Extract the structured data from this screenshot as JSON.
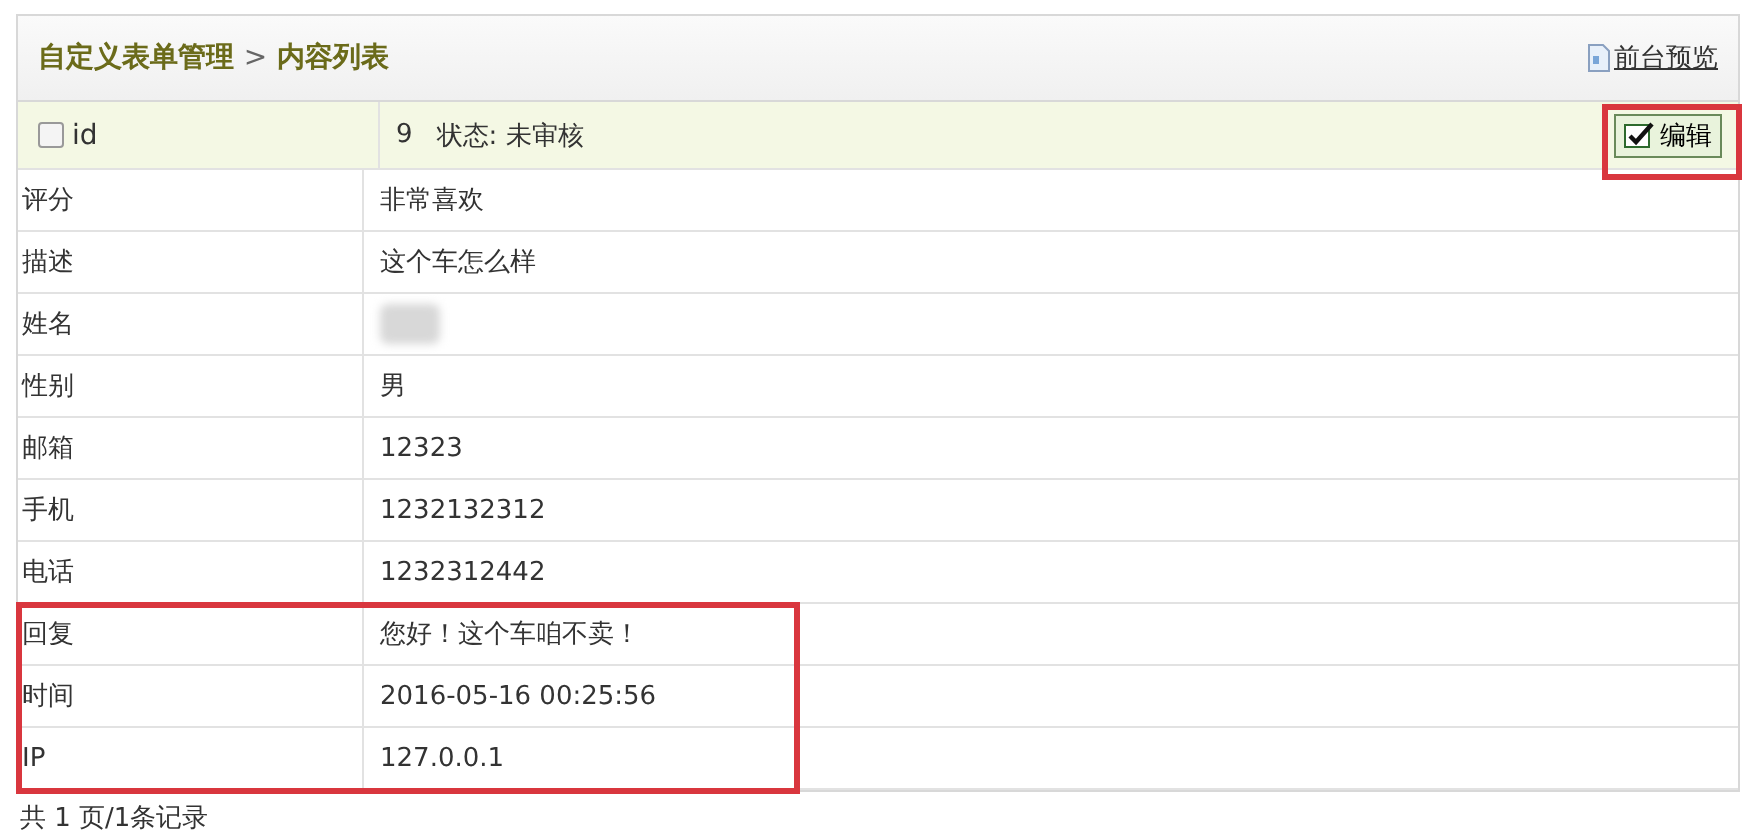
{
  "breadcrumb": {
    "root": "自定义表单管理",
    "separator": ">",
    "current": "内容列表"
  },
  "preview_link": {
    "label": "前台预览"
  },
  "header_row": {
    "label": "id",
    "checked": false,
    "id": "9",
    "status_label": "状态:",
    "status": "未审核",
    "edit_button": {
      "label": "编辑",
      "highlighted": true
    }
  },
  "rows": [
    {
      "label": "评分",
      "kind": "text",
      "value": "非常喜欢",
      "highlighted": false
    },
    {
      "label": "描述",
      "kind": "text",
      "value": "这个车怎么样",
      "highlighted": false
    },
    {
      "label": "姓名",
      "kind": "blurred",
      "highlighted": false
    },
    {
      "label": "性别",
      "kind": "text",
      "value": "男",
      "highlighted": false
    },
    {
      "label": "邮箱",
      "kind": "text",
      "value": "12323",
      "highlighted": false
    },
    {
      "label": "手机",
      "kind": "text",
      "value": "1232132312",
      "highlighted": false
    },
    {
      "label": "电话",
      "kind": "text",
      "value": "1232312442",
      "highlighted": false
    },
    {
      "label": "回复",
      "kind": "text",
      "value": "您好！这个车咱不卖！",
      "highlighted": true
    },
    {
      "label": "时间",
      "kind": "text",
      "value": "2016-05-16 00:25:56",
      "highlighted": true
    },
    {
      "label": "IP",
      "kind": "text",
      "value": "127.0.0.1",
      "highlighted": true
    }
  ],
  "footer": "共 1 页/1条记录"
}
